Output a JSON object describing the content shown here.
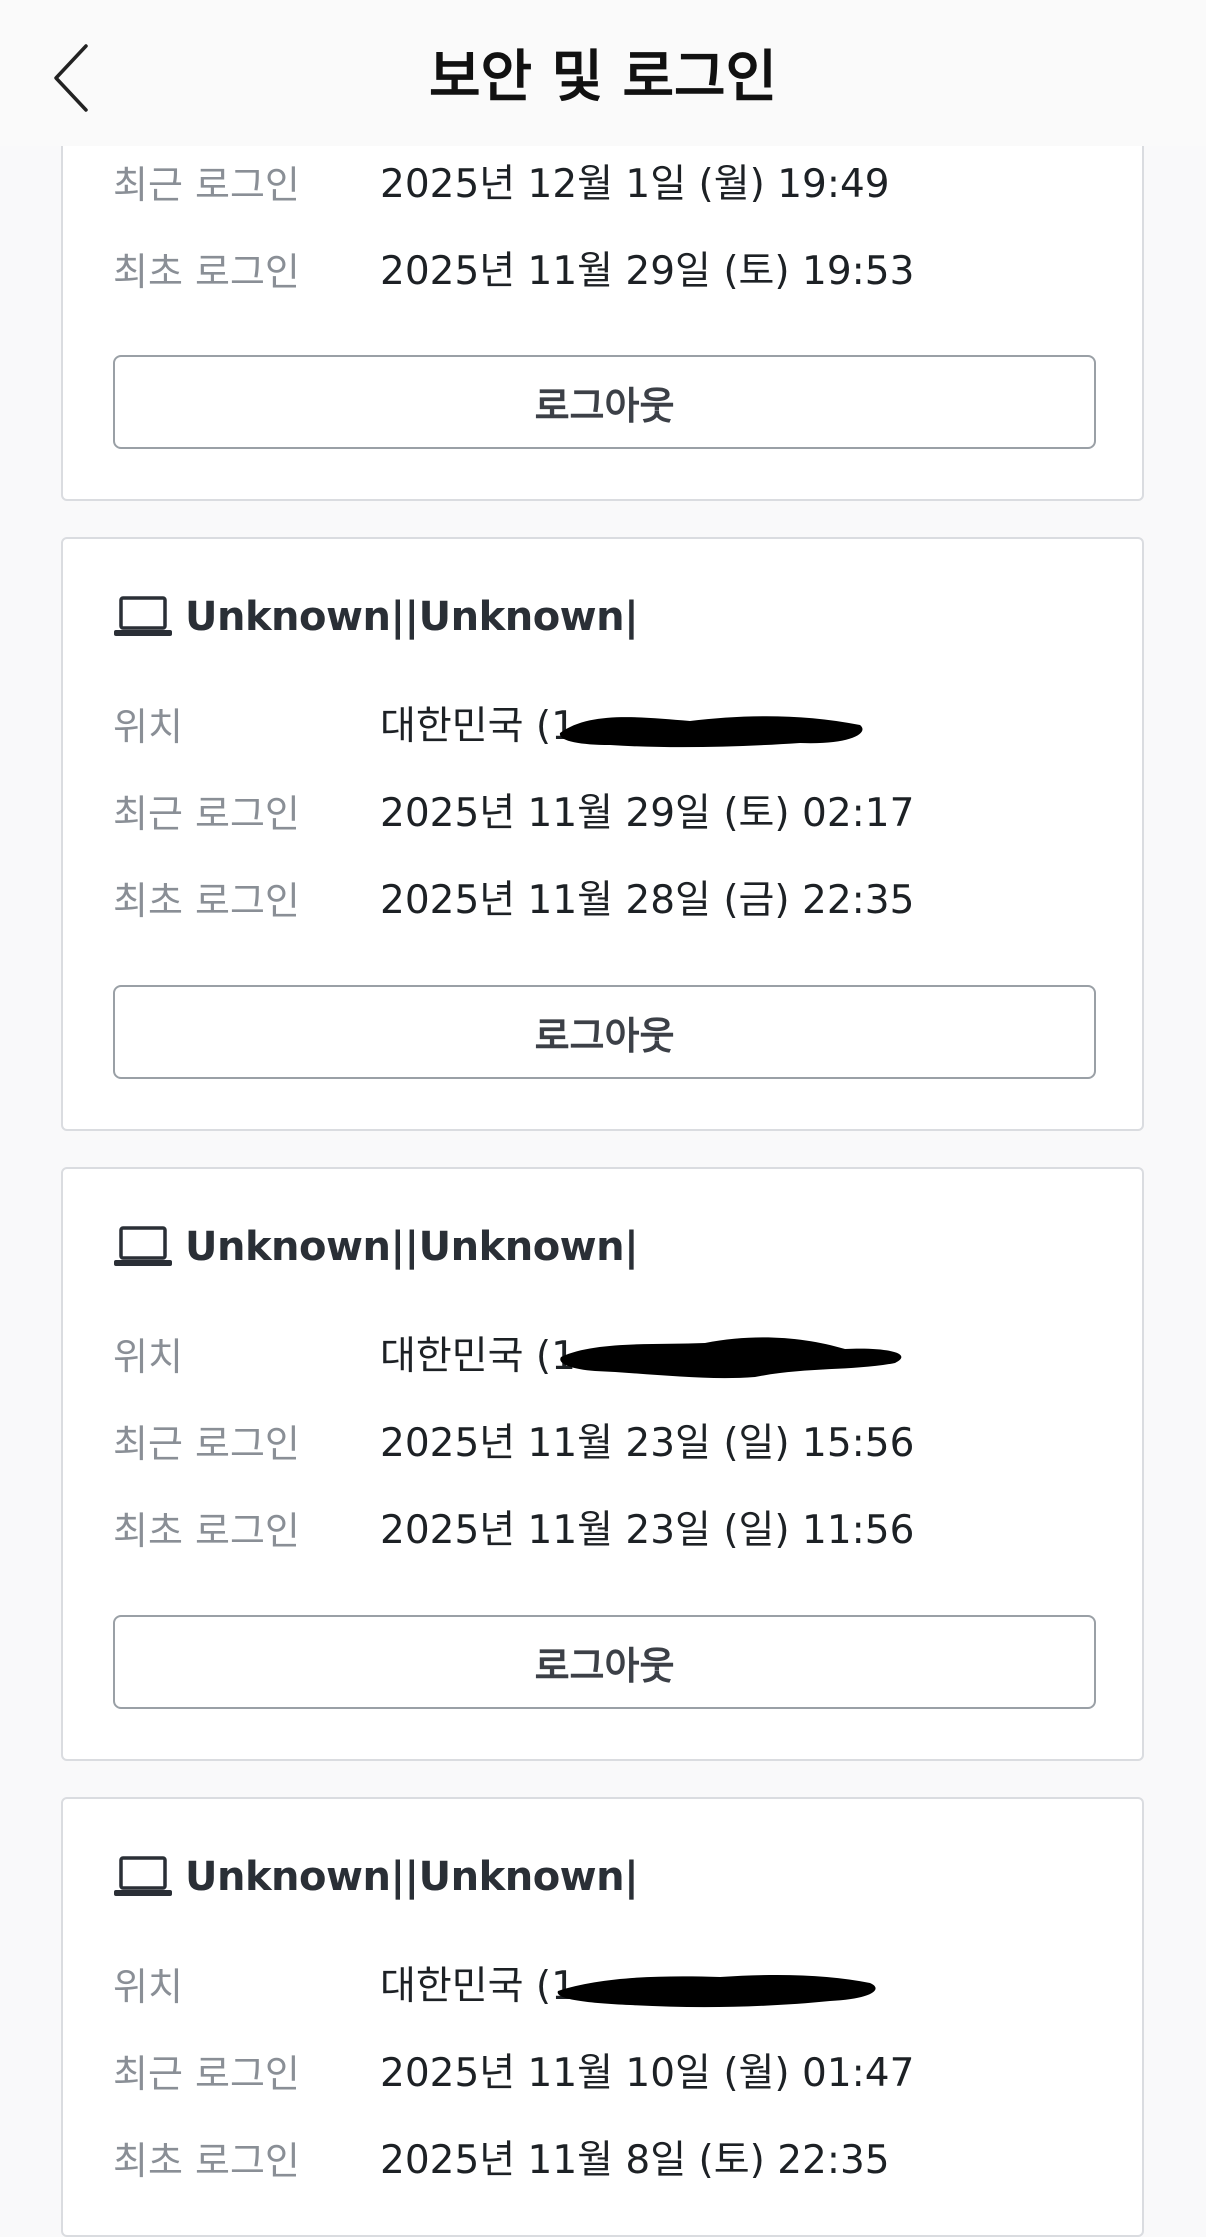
{
  "header": {
    "title": "보안 및 로그인"
  },
  "labels": {
    "location": "위치",
    "recent_login": "최근 로그인",
    "first_login": "최초 로그인",
    "logout": "로그아웃"
  },
  "sessions": [
    {
      "recent_login": "2025년 12월 1일 (월) 19:49",
      "first_login": "2025년 11월 29일 (토) 19:53"
    },
    {
      "device": "Unknown||Unknown|",
      "location": "대한민국 (1",
      "recent_login": "2025년 11월 29일 (토) 02:17",
      "first_login": "2025년 11월 28일 (금) 22:35"
    },
    {
      "device": "Unknown||Unknown|",
      "location": "대한민국 (1",
      "recent_login": "2025년 11월 23일 (일) 15:56",
      "first_login": "2025년 11월 23일 (일) 11:56"
    },
    {
      "device": "Unknown||Unknown|",
      "location": "대한민국 (1",
      "recent_login": "2025년 11월 10일 (월) 01:47",
      "first_login": "2025년 11월 8일 (토) 22:35"
    }
  ],
  "icons": {
    "back": "chevron-left-icon",
    "device": "laptop-icon"
  }
}
